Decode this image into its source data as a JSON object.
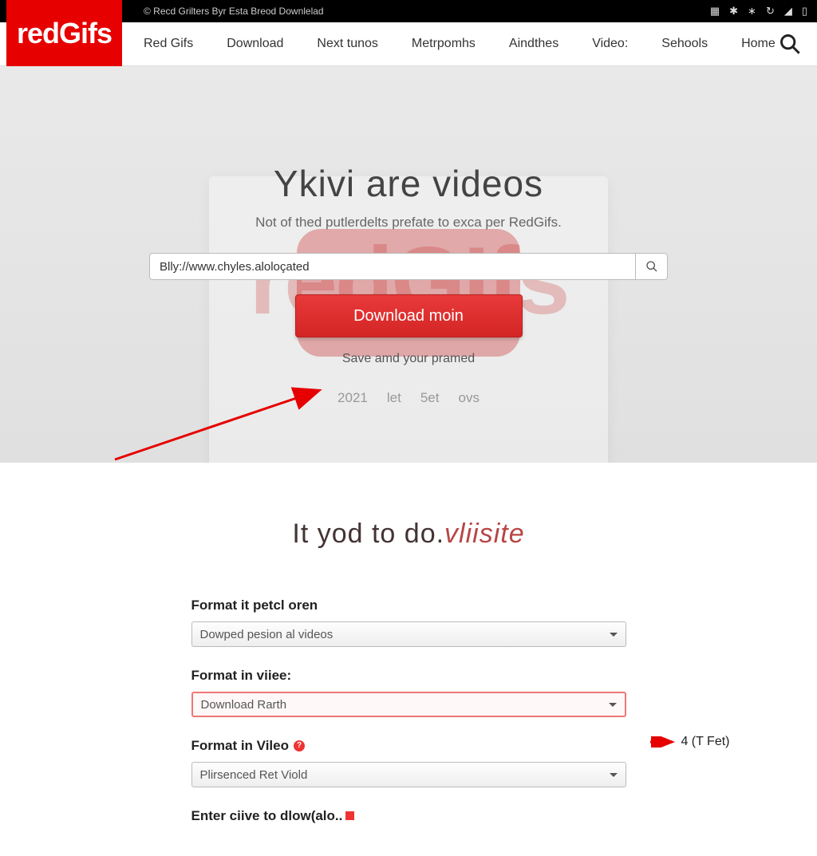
{
  "brand": {
    "logo_text": "redGifs"
  },
  "topbar": {
    "tagline": "© Recd Grilters Byr Esta Breod Downlelad",
    "status_icons": [
      "cast-icon",
      "sync-icon",
      "bluetooth-icon",
      "loop-icon",
      "signal-icon",
      "battery-icon"
    ]
  },
  "nav": {
    "items": [
      "Red Gifs",
      "Download",
      "Next tunos",
      "Metrpomhs",
      "Aindthes",
      "Video:",
      "Sehools",
      "Home"
    ]
  },
  "hero": {
    "bg_brand": "redGIfs",
    "title": "Ykivi are videos",
    "subtitle": "Not of thed putlerdelts prefate to exca per RedGifs.",
    "url_value": "Blly://www.chyles.aloloçated",
    "download_button": "Download moin",
    "helper_text": "Save amd your pramed",
    "meta": [
      "2021",
      "let",
      "5et",
      "ovs"
    ]
  },
  "lower": {
    "heading_a": "It yod to do.",
    "heading_b": "vliisite",
    "fields": [
      {
        "label": "Format it petcl oren",
        "value": "Dowped pesion al videos"
      },
      {
        "label": "Format in viiee:",
        "value": "Download Rarth"
      },
      {
        "label": "Format in Vileo",
        "value": "Plirsenced Ret Viold"
      }
    ],
    "side_note": "4 (T Fet)",
    "final_label": "Enter ciive to dlow(alo.."
  }
}
